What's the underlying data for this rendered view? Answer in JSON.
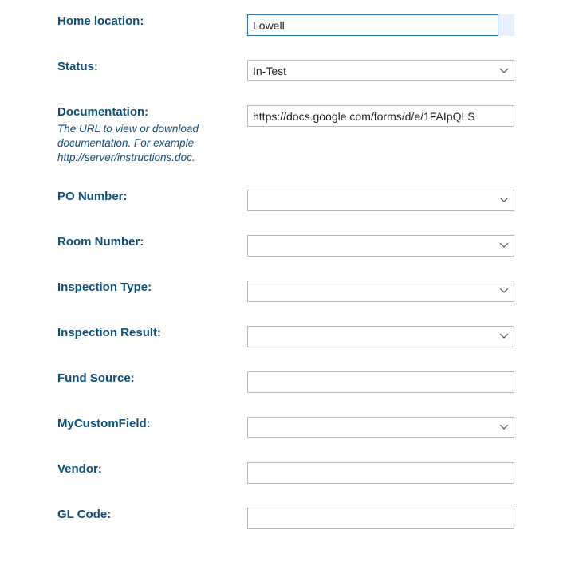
{
  "fields": {
    "home_location": {
      "label": "Home location:",
      "value": "Lowell"
    },
    "status": {
      "label": "Status:",
      "value": "In-Test"
    },
    "documentation": {
      "label": "Documentation:",
      "help": "The URL to view or download documentation.  For example http://server/instructions.doc.",
      "value": "https://docs.google.com/forms/d/e/1FAIpQLS"
    },
    "po_number": {
      "label": "PO Number:",
      "value": ""
    },
    "room_number": {
      "label": "Room Number:",
      "value": ""
    },
    "inspection_type": {
      "label": "Inspection Type:",
      "value": ""
    },
    "inspection_result": {
      "label": "Inspection Result:",
      "value": ""
    },
    "fund_source": {
      "label": "Fund Source:",
      "value": ""
    },
    "my_custom_field": {
      "label": "MyCustomField:",
      "value": ""
    },
    "vendor": {
      "label": "Vendor:",
      "value": ""
    },
    "gl_code": {
      "label": "GL Code:",
      "value": ""
    }
  }
}
